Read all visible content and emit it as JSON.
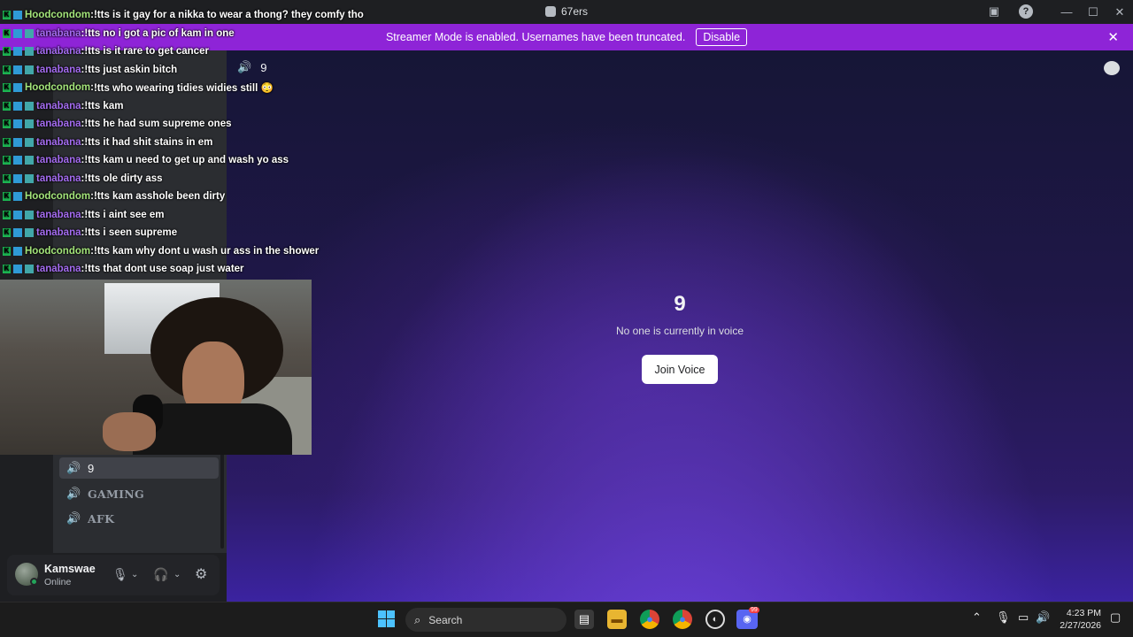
{
  "window": {
    "title": "67ers",
    "help_label": "?",
    "minimize": "—",
    "maximize": "☐",
    "close": "✕"
  },
  "banner": {
    "message": "Streamer Mode is enabled. Usernames have been truncated.",
    "disable_label": "Disable",
    "close": "✕"
  },
  "sidebar": {
    "voice_channels": [
      {
        "name": "9",
        "active": true
      },
      {
        "name": "GAMING",
        "active": false
      },
      {
        "name": "AFK",
        "active": false
      }
    ]
  },
  "user": {
    "name": "Kamswae",
    "status": "Online"
  },
  "voice": {
    "channel_name": "9",
    "title": "9",
    "subtitle": "No one is currently in voice",
    "join_label": "Join Voice"
  },
  "chat": [
    {
      "user": "Hoodcondom",
      "color": "#a3e47a",
      "text": "!tts is it gay for a nikka to wear a thong? they comfy tho"
    },
    {
      "user": "tanabana",
      "color": "#a46cf0",
      "text": "!tts no i got a pic of kam in one"
    },
    {
      "user": "tanabana",
      "color": "#a46cf0",
      "text": "!tts is it rare to get cancer"
    },
    {
      "user": "tanabana",
      "color": "#a46cf0",
      "text": "!tts just askin bitch"
    },
    {
      "user": "Hoodcondom",
      "color": "#a3e47a",
      "text": "!tts who wearing tidies widies still 😳"
    },
    {
      "user": "tanabana",
      "color": "#a46cf0",
      "text": "!tts kam"
    },
    {
      "user": "tanabana",
      "color": "#a46cf0",
      "text": "!tts he had sum supreme ones"
    },
    {
      "user": "tanabana",
      "color": "#a46cf0",
      "text": "!tts it had shit stains in em"
    },
    {
      "user": "tanabana",
      "color": "#a46cf0",
      "text": "!tts kam u need to get up and wash yo ass"
    },
    {
      "user": "tanabana",
      "color": "#a46cf0",
      "text": "!tts ole dirty ass"
    },
    {
      "user": "Hoodcondom",
      "color": "#a3e47a",
      "text": "!tts kam asshole been dirty"
    },
    {
      "user": "tanabana",
      "color": "#a46cf0",
      "text": "!tts i aint see em"
    },
    {
      "user": "tanabana",
      "color": "#a46cf0",
      "text": "!tts i seen supreme"
    },
    {
      "user": "Hoodcondom",
      "color": "#a3e47a",
      "text": "!tts kam why dont u wash ur ass in the shower"
    },
    {
      "user": "tanabana",
      "color": "#a46cf0",
      "text": "!tts that dont use soap just water"
    }
  ],
  "taskbar": {
    "search_placeholder": "Search",
    "time": "4:23 PM",
    "date": "2/27/2026",
    "discord_badge": "99"
  }
}
